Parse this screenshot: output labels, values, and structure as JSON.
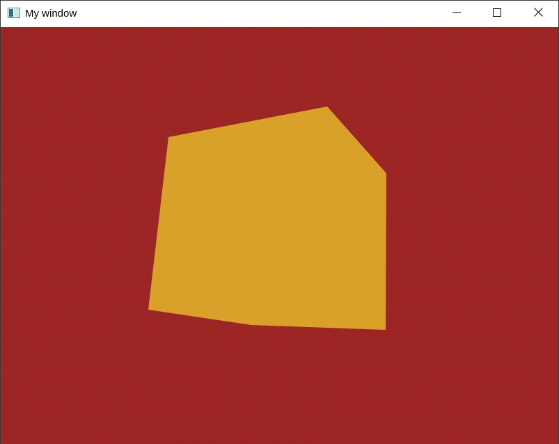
{
  "window": {
    "title": "My window",
    "app_icon": "window-app-icon",
    "controls": {
      "minimize_icon": "minimize-icon",
      "maximize_icon": "maximize-icon",
      "close_icon": "close-icon"
    }
  },
  "scene": {
    "background_color": "#9b2424",
    "shape": {
      "name": "yellow-quad-shape",
      "fill_color": "#d9a12a"
    }
  }
}
